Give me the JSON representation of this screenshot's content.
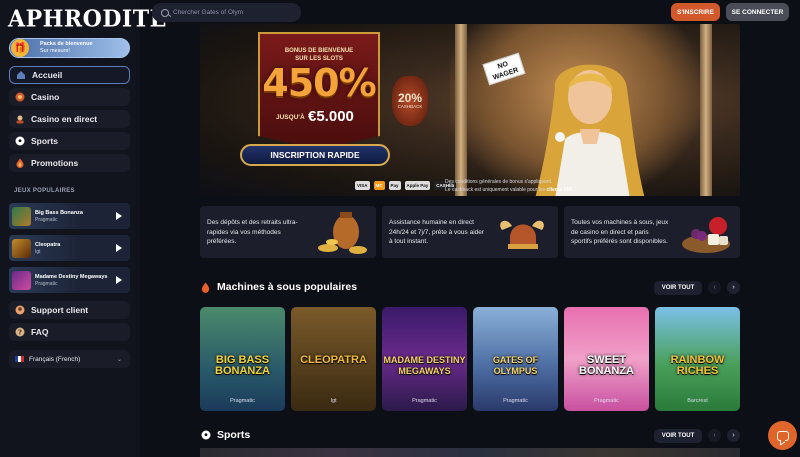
{
  "brand": {
    "logo_text": "APHRODITE"
  },
  "search": {
    "placeholder": "Chercher Gates of Olym"
  },
  "header": {
    "signup_label": "S'INSCRIRE",
    "login_label": "SE CONNECTER"
  },
  "sidebar": {
    "promo": {
      "line1": "Packs de bienvenue",
      "line2": "Sur mesure!"
    },
    "nav": [
      {
        "label": "Accueil",
        "icon": "home-icon"
      },
      {
        "label": "Casino",
        "icon": "casino-chip-icon"
      },
      {
        "label": "Casino en direct",
        "icon": "live-dealer-icon"
      },
      {
        "label": "Sports",
        "icon": "soccer-ball-icon"
      },
      {
        "label": "Promotions",
        "icon": "flame-icon"
      }
    ],
    "popular_label": "JEUX POPULAIRES",
    "popular_games": [
      {
        "name": "Big Bass Bonanza",
        "provider": "Pragmatic"
      },
      {
        "name": "Cleopatra",
        "provider": "Igt"
      },
      {
        "name": "Madame Destiny Megaways",
        "provider": "Pragmatic"
      }
    ],
    "support_label": "Support client",
    "faq_label": "FAQ",
    "language": "Français (French)"
  },
  "hero": {
    "bonus_title_1": "BONUS DE BIENVENUE",
    "bonus_title_2": "SUR LES SLOTS",
    "bonus_percent": "450%",
    "upto": "JUSQU'À",
    "amount": "€5.000",
    "cashback_pct": "20%",
    "cashback_label": "CASHBACK",
    "nowager_1": "NO",
    "nowager_2": "WAGER",
    "cta_label": "INSCRIPTION RAPIDE",
    "payments": [
      "VISA",
      "MC",
      "Pay",
      "Apple Pay",
      "CASHlib"
    ],
    "terms_1": "Des conditions générales de bonus s'appliquent.",
    "terms_2": "Le cashback est uniquement valable pour les ",
    "terms_vip": "clients VIP."
  },
  "features": [
    {
      "text": "Des dépôts et des retraits ultra-rapides via vos méthodes préférées."
    },
    {
      "text": "Assistance humaine en direct 24h/24 et 7j/7, prête à vous aider à tout instant."
    },
    {
      "text": "Toutes vos machines à sous, jeux de casino en direct et paris sportifs préférés sont disponibles."
    }
  ],
  "slots_section": {
    "title": "Machines à sous populaires",
    "see_all": "VOIR TOUT",
    "games": [
      {
        "name": "BIG BASS BONANZA",
        "provider": "Pragmatic"
      },
      {
        "name": "CLEOPATRA",
        "provider": "Igt"
      },
      {
        "name": "MADAME DESTINY MEGAWAYS",
        "provider": "Pragmatic"
      },
      {
        "name": "GATES OF OLYMPUS",
        "provider": "Pragmatic"
      },
      {
        "name": "SWEET BONANZA",
        "provider": "Pragmatic"
      },
      {
        "name": "RAINBOW RICHES",
        "provider": "Barcrest"
      }
    ]
  },
  "sports_section": {
    "title": "Sports",
    "see_all": "VOIR TOUT"
  }
}
